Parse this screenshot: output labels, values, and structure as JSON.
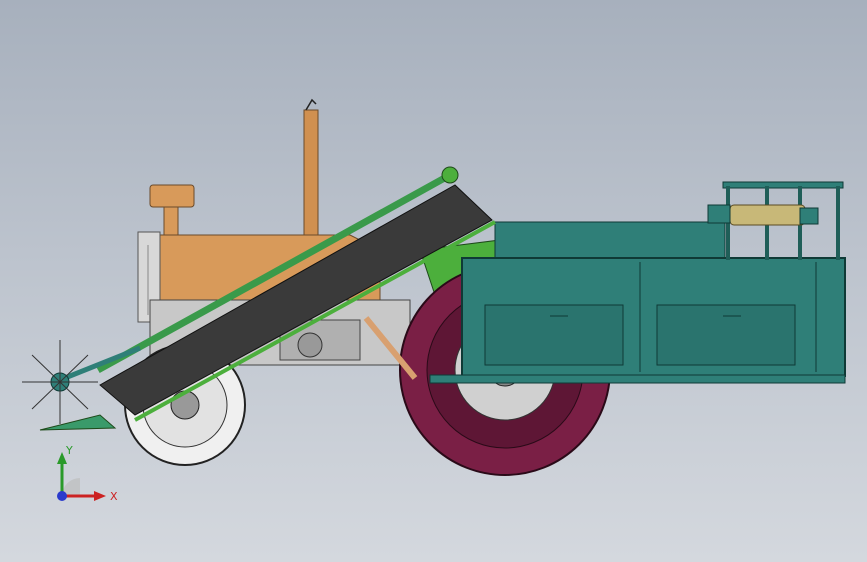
{
  "viewport": {
    "background_top": "#a7b0bd",
    "background_bottom": "#d4d8de"
  },
  "model": {
    "colors": {
      "engine_orange": "#d89a5a",
      "exhaust": "#d09050",
      "body_teal": "#2f7f78",
      "body_teal_dark": "#1f5e58",
      "frame_green": "#4caf3c",
      "belt_dark": "#3a3a3a",
      "tire_rear": "#7a1f45",
      "tire_front": "#e8e8e8",
      "chassis_grey": "#b8b8b8"
    }
  },
  "triad": {
    "x_label": "X",
    "y_label": "Y",
    "x_color": "#cc2222",
    "y_color": "#2a9a2a",
    "z_color": "#2a3acc"
  }
}
